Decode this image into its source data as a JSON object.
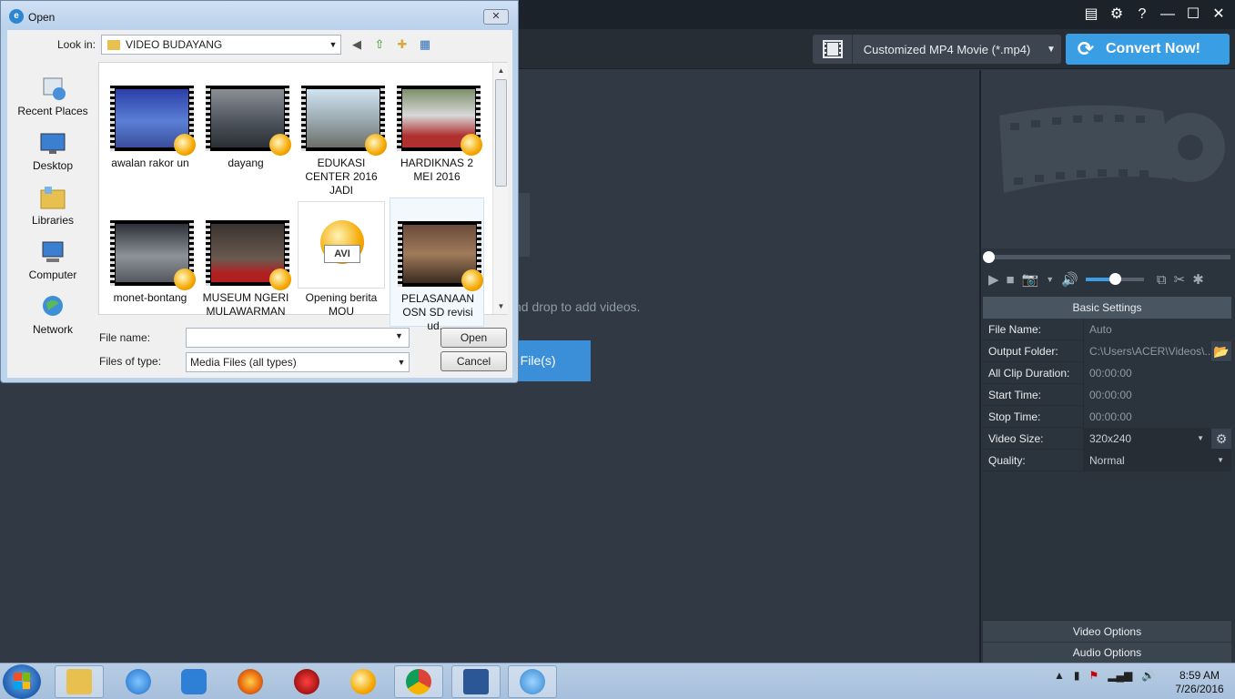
{
  "app": {
    "output_format": "Customized MP4 Movie (*.mp4)",
    "convert_label": "Convert Now!",
    "drop_hint": "nd drop to add videos.",
    "add_files_label": "g File(s)",
    "accent_color": "#3a9ee4"
  },
  "settings": {
    "header": "Basic Settings",
    "rows": [
      {
        "label": "File Name:",
        "value": "Auto"
      },
      {
        "label": "Output Folder:",
        "value": "C:\\Users\\ACER\\Videos\\..."
      },
      {
        "label": "All Clip Duration:",
        "value": "00:00:00"
      },
      {
        "label": "Start Time:",
        "value": "00:00:00"
      },
      {
        "label": "Stop Time:",
        "value": "00:00:00"
      },
      {
        "label": "Video Size:",
        "value": "320x240"
      },
      {
        "label": "Quality:",
        "value": "Normal"
      }
    ],
    "video_options": "Video Options",
    "audio_options": "Audio Options"
  },
  "player": {
    "volume_level": 0.5,
    "seek_position": 0
  },
  "dialog": {
    "title": "Open",
    "look_in_label": "Look in:",
    "look_in_value": "VIDEO BUDAYANG",
    "places": [
      "Recent Places",
      "Desktop",
      "Libraries",
      "Computer",
      "Network"
    ],
    "files": [
      {
        "name": "awalan rakor un"
      },
      {
        "name": "dayang"
      },
      {
        "name": "EDUKASI CENTER 2016 JADI"
      },
      {
        "name": "HARDIKNAS 2 MEI 2016"
      },
      {
        "name": "monet-bontang"
      },
      {
        "name": "MUSEUM NGERI MULAWARMAN"
      },
      {
        "name": "Opening berita MOU"
      },
      {
        "name": "PELASANAAN OSN SD revisi ud..."
      }
    ],
    "avi_label": "AVI",
    "file_name_label": "File name:",
    "file_name_value": "",
    "files_of_type_label": "Files of type:",
    "files_of_type_value": "Media Files (all types)",
    "open_label": "Open",
    "cancel_label": "Cancel"
  },
  "taskbar": {
    "time": "8:59 AM",
    "date": "7/26/2016"
  }
}
